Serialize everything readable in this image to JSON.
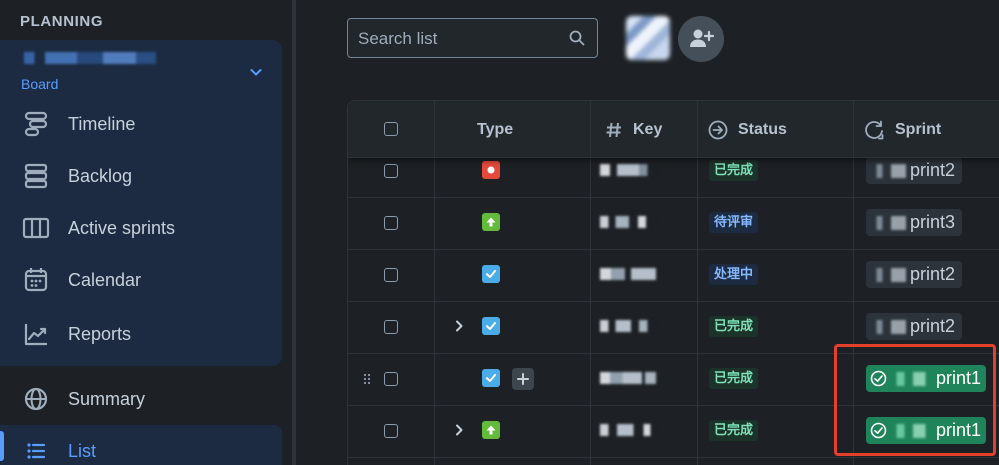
{
  "sidebar": {
    "section_title": "PLANNING",
    "project_subtitle": "Board",
    "items": [
      {
        "id": "timeline",
        "label": "Timeline"
      },
      {
        "id": "backlog",
        "label": "Backlog"
      },
      {
        "id": "active-sprints",
        "label": "Active sprints"
      },
      {
        "id": "calendar",
        "label": "Calendar"
      },
      {
        "id": "reports",
        "label": "Reports"
      }
    ],
    "summary_label": "Summary",
    "list_label": "List"
  },
  "toolbar": {
    "search_placeholder": "Search list"
  },
  "table": {
    "columns": {
      "type": "Type",
      "key": "Key",
      "status": "Status",
      "sprint": "Sprint"
    },
    "rows": [
      {
        "type_icon": "bug-icon",
        "type_color": "#e5493a",
        "status": "已完成",
        "status_kind": "done",
        "sprint": "print2",
        "sprint_active": false,
        "expandable": false,
        "hover": false
      },
      {
        "type_icon": "story-icon",
        "type_color": "#63ba3c",
        "status": "待评审",
        "status_kind": "review",
        "sprint": "print3",
        "sprint_active": false,
        "expandable": false,
        "hover": false
      },
      {
        "type_icon": "task-icon",
        "type_color": "#4bade8",
        "status": "处理中",
        "status_kind": "progress",
        "sprint": "print2",
        "sprint_active": false,
        "expandable": false,
        "hover": false
      },
      {
        "type_icon": "task-icon",
        "type_color": "#4bade8",
        "status": "已完成",
        "status_kind": "done",
        "sprint": "print2",
        "sprint_active": false,
        "expandable": true,
        "hover": false
      },
      {
        "type_icon": "task-icon",
        "type_color": "#4bade8",
        "status": "已完成",
        "status_kind": "done",
        "sprint": "print1",
        "sprint_active": true,
        "expandable": false,
        "hover": true
      },
      {
        "type_icon": "story-icon",
        "type_color": "#63ba3c",
        "status": "已完成",
        "status_kind": "done",
        "sprint": "print1",
        "sprint_active": true,
        "expandable": true,
        "hover": false
      }
    ]
  },
  "colors": {
    "background": "#1d2125",
    "accent": "#579dff",
    "highlight": "#e5402b",
    "active_sprint": "#1f845a"
  }
}
